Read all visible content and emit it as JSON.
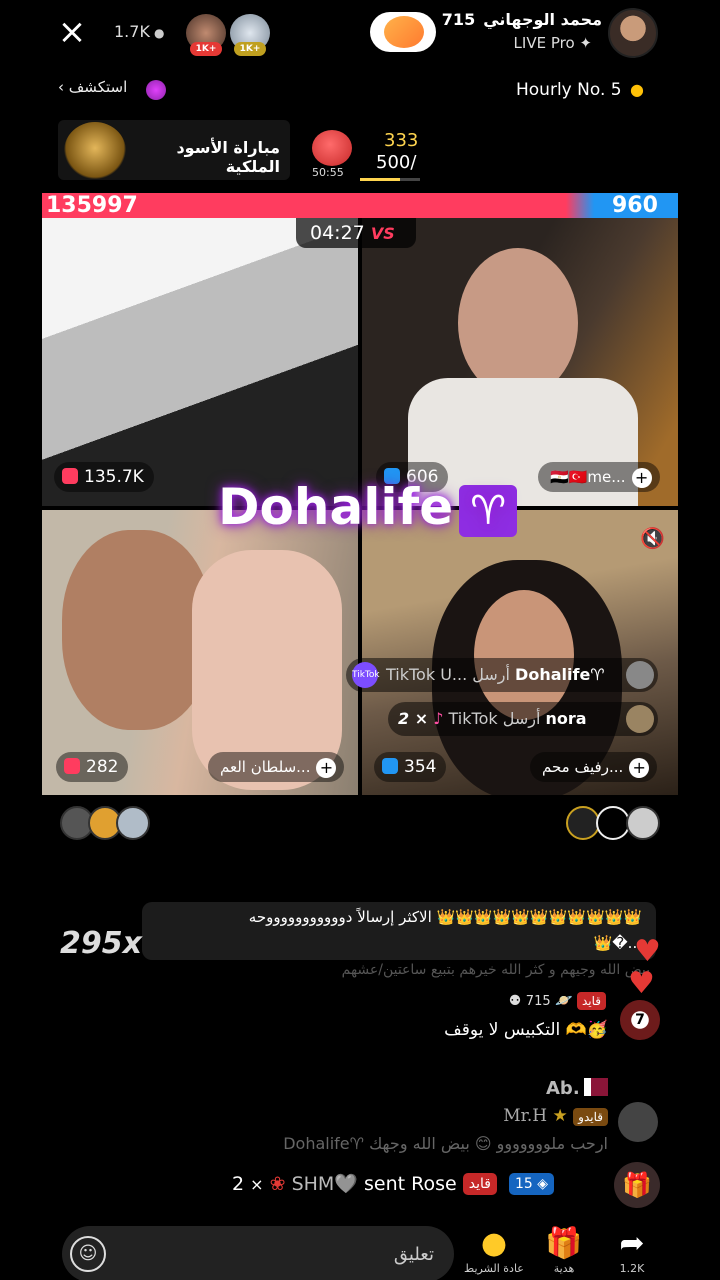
{
  "top_bar": {
    "close_icon": "×",
    "viewer_count": "1.7K",
    "top_avatar_badges": [
      "1K+",
      "1K+"
    ],
    "host_name": "محمد الوجهاني",
    "host_level": "715",
    "host_subtitle": "LIVE Pro"
  },
  "nav": {
    "explore_label": "استكشف",
    "hourly_label": "Hourly No. 5"
  },
  "match": {
    "title": "مباراة الأسود الملكية",
    "timer": "50:55",
    "goal_current": "333",
    "goal_total": "500/",
    "goal_progress": 0.67
  },
  "battle": {
    "score_left": "135997",
    "score_right": "960",
    "timer": "04:27",
    "vs_label": "VS"
  },
  "cells": {
    "cell1": {
      "count": "135.7K"
    },
    "cell2": {
      "count": "606",
      "name": "me...",
      "flags": "🇪🇬🇹🇷"
    },
    "cell3": {
      "count": "282",
      "name": "سلطان العم..."
    },
    "cell4": {
      "count": "354",
      "name": "رفيف محم..."
    }
  },
  "overlay": {
    "name": "Dohalife",
    "symbol": "♈"
  },
  "gift_popups": [
    {
      "badge": "TikTok",
      "text": "TikTok U... أرسل",
      "user": "Dohalife♈"
    },
    {
      "badge": "",
      "multiplier": "2 ×",
      "text": "TikTok أرسل",
      "user": "nora"
    }
  ],
  "chat": {
    "top_sender_line1": "الاكثر إرسالاً دوووووووووووحه 👑👑👑👑👑👑👑👑👑👑👑",
    "top_sender_line2": "👑�...",
    "combo": "295x",
    "faded_line": "بيض الله وجيهم و كثر الله خيرهم بتبيع ساعتين/عشهم",
    "msg1_level": "715",
    "msg1_tag": "قايد",
    "msg1_text": "التكبيس لا يوقف 🫶🥳",
    "msg1_avatar_label": "7",
    "ab_name": "Ab.",
    "mrh_name": "Mr.H",
    "mrh_tag": "قايدو",
    "faded_line2": "Dohalife♈ ارحب ملووووووو 😊 بيض الله وجهك",
    "gift_line_user": "SHM🩶",
    "gift_line_text": "sent Rose",
    "gift_line_count": "2",
    "gift_line_multiplier": "×",
    "gift_line_tag": "قايد",
    "gift_line_level": "15"
  },
  "bottom": {
    "comment_placeholder": "تعليق",
    "rewatch_label": "إعادة الشريط",
    "gift_label": "هدية",
    "share_label": "1.2K"
  },
  "colors": {
    "battle_red": "#ff3c5f",
    "battle_blue": "#2196f3",
    "accent_purple": "#8e2de2",
    "gold": "#ffd54f"
  }
}
